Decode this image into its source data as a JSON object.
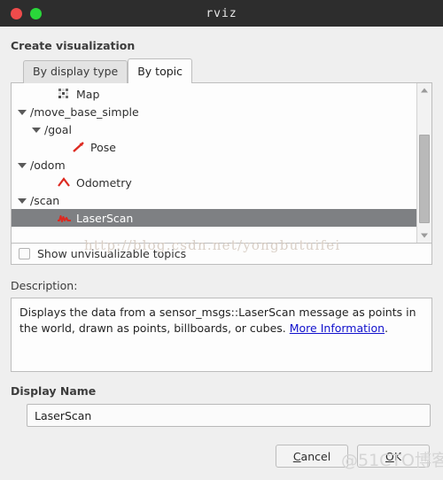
{
  "window": {
    "title": "rviz",
    "controls": [
      {
        "name": "close",
        "color": "#ee4b4b"
      },
      {
        "name": "maximize",
        "color": "#2ad63a"
      }
    ]
  },
  "dialog": {
    "section_title": "Create visualization",
    "tabs": [
      {
        "label": "By display type",
        "active": false
      },
      {
        "label": "By topic",
        "active": true
      }
    ],
    "tree": [
      {
        "label": "Map",
        "indent": 2,
        "arrow": false,
        "icon": "map-icon",
        "selected": false
      },
      {
        "label": "/move_base_simple",
        "indent": 0,
        "arrow": true,
        "icon": "none",
        "selected": false
      },
      {
        "label": "/goal",
        "indent": 1,
        "arrow": true,
        "icon": "none",
        "selected": false
      },
      {
        "label": "Pose",
        "indent": 3,
        "arrow": false,
        "icon": "pose-icon",
        "selected": false
      },
      {
        "label": "/odom",
        "indent": 0,
        "arrow": true,
        "icon": "none",
        "selected": false
      },
      {
        "label": "Odometry",
        "indent": 2,
        "arrow": false,
        "icon": "odometry-icon",
        "selected": false
      },
      {
        "label": "/scan",
        "indent": 0,
        "arrow": true,
        "icon": "none",
        "selected": false
      },
      {
        "label": "LaserScan",
        "indent": 2,
        "arrow": false,
        "icon": "laserscan-icon",
        "selected": true
      }
    ],
    "checkbox": {
      "label": "Show unvisualizable topics",
      "checked": false
    },
    "description": {
      "label": "Description:",
      "text_before": "Displays the data from a sensor_msgs::LaserScan message as points in the world, drawn as points, billboards, or cubes. ",
      "link_text": "More Information",
      "text_after": "."
    },
    "display_name": {
      "label": "Display Name",
      "value": "LaserScan"
    },
    "buttons": [
      {
        "name": "cancel",
        "mnemonic": "C",
        "before": "",
        "after": "ancel"
      },
      {
        "name": "ok",
        "mnemonic": "O",
        "before": "",
        "after": "K"
      }
    ]
  },
  "colors": {
    "titlebar": "#2d2d2d",
    "selection": "#7e8083",
    "icon_red": "#dd2a21",
    "link": "#1111cc",
    "window_bg": "#efefef"
  },
  "watermarks": {
    "csdn": "http://blog.csdn.net/yongbutuifei",
    "cto": "@51CTO博客"
  }
}
